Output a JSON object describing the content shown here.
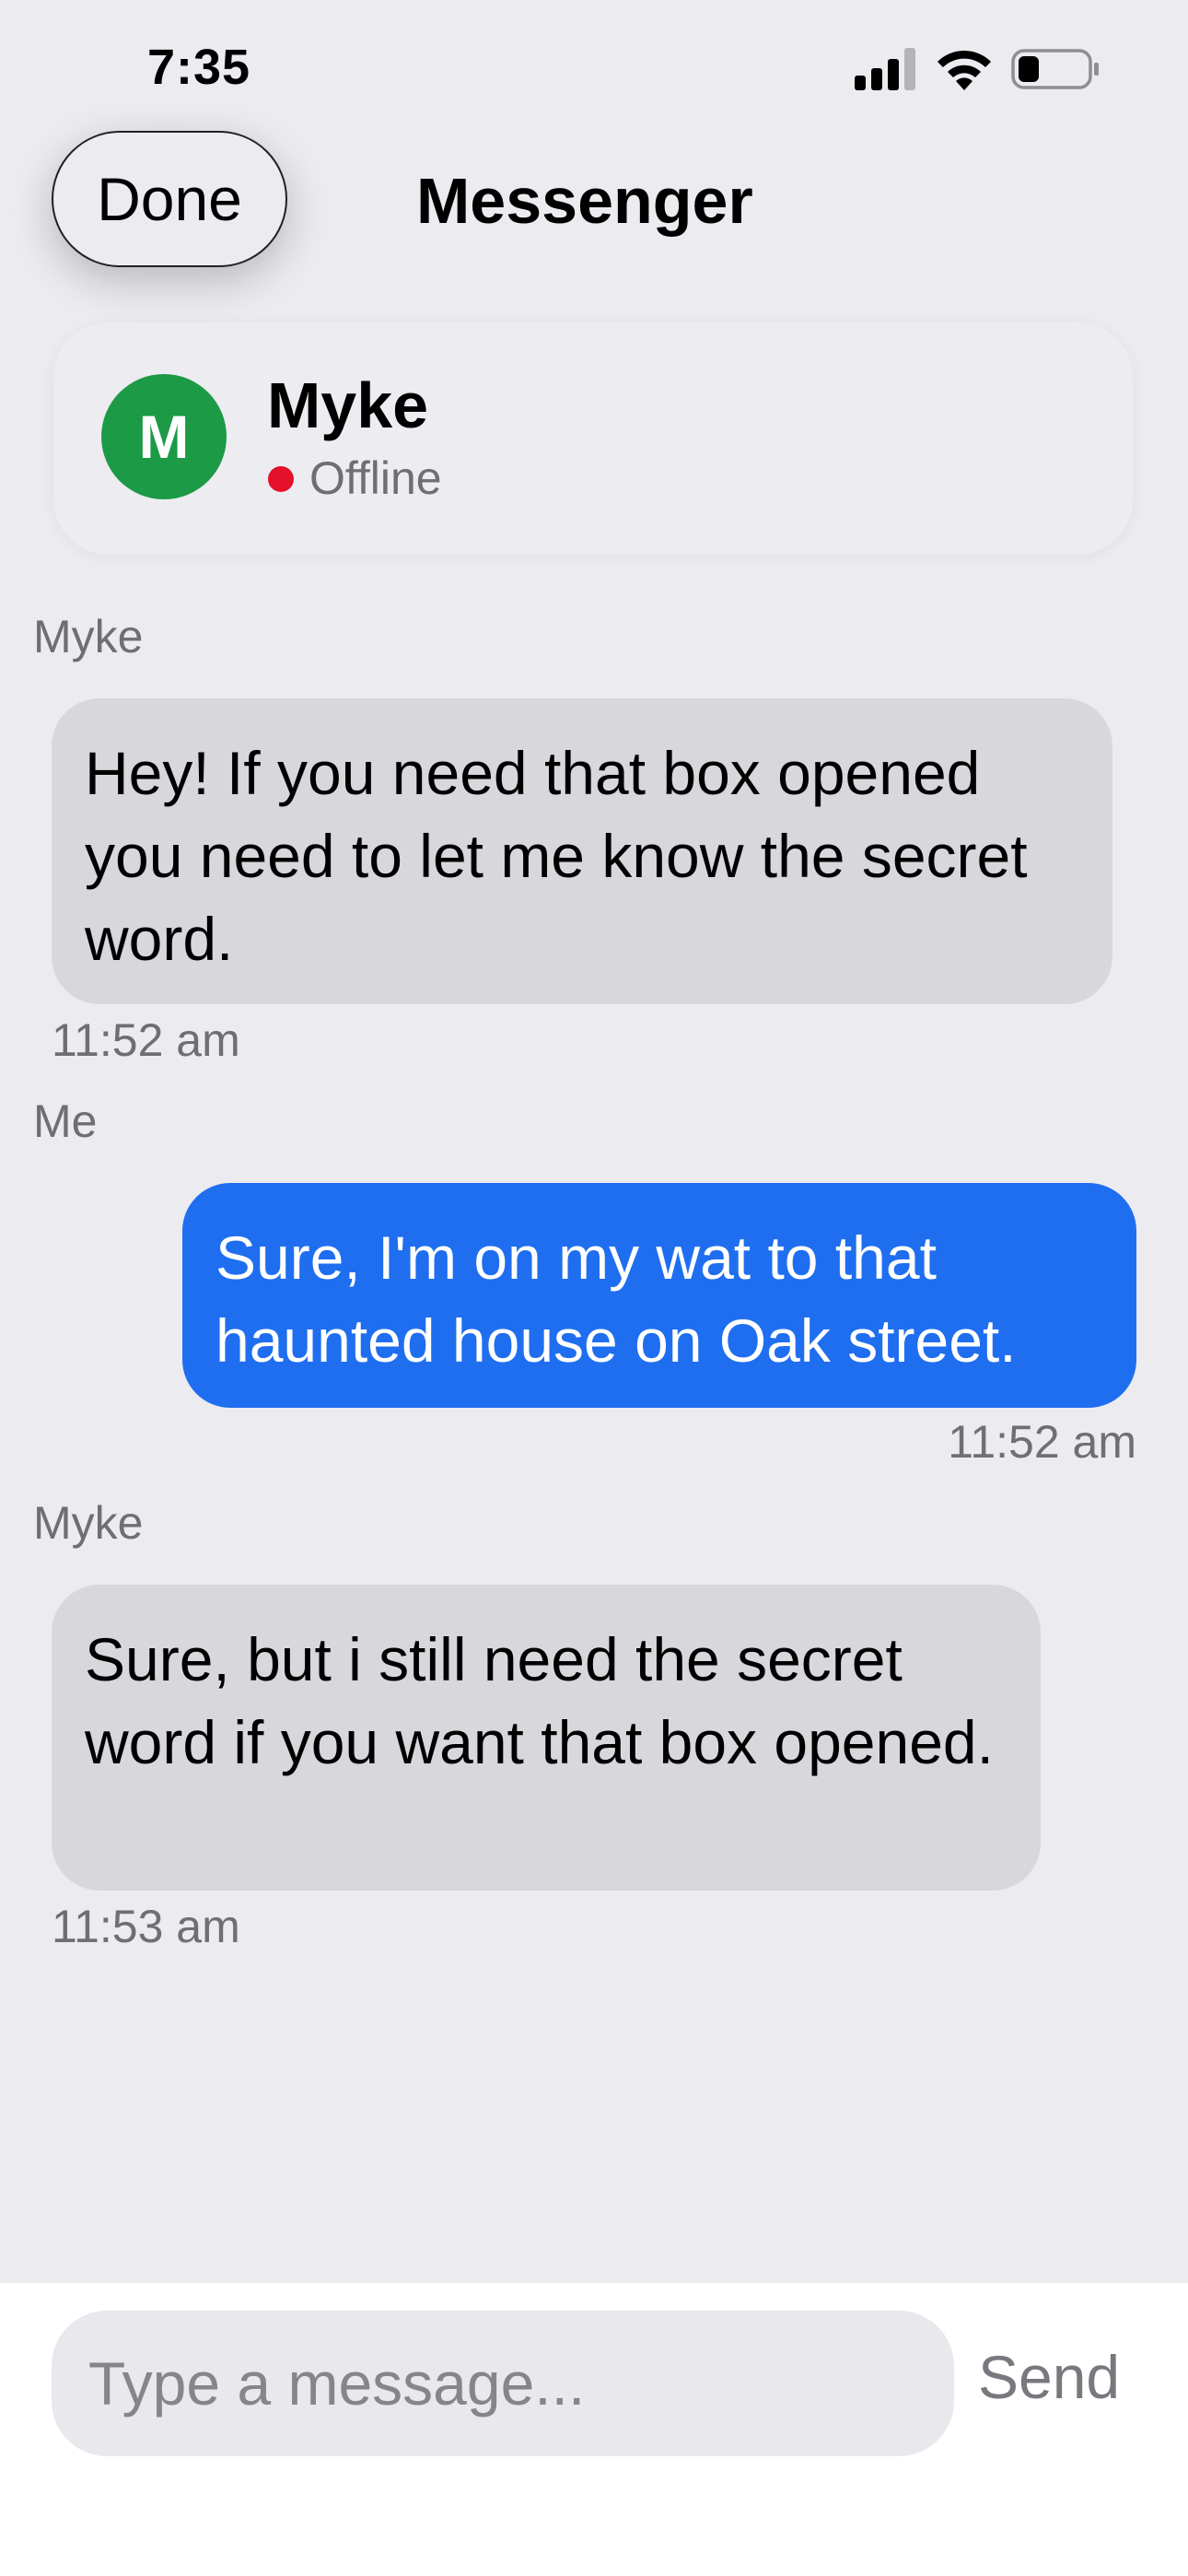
{
  "status_bar": {
    "time": "7:35",
    "icons": [
      "signal-icon",
      "wifi-icon",
      "battery-icon"
    ]
  },
  "nav": {
    "done_label": "Done",
    "title": "Messenger"
  },
  "contact": {
    "initial": "M",
    "name": "Myke",
    "status": "Offline",
    "avatar_color": "#1c9a46",
    "status_color": "#e5102a"
  },
  "messages": [
    {
      "sender": "Myke",
      "direction": "incoming",
      "text": "Hey! If you need that box opened you need to let me know the secret word.",
      "time": "11:52 am"
    },
    {
      "sender": "Me",
      "direction": "outgoing",
      "text": "Sure, I'm on my wat to that haunted house on Oak street.",
      "time": "11:52 am"
    },
    {
      "sender": "Myke",
      "direction": "incoming",
      "text": "Sure, but i still need the secret word if you want that box opened.",
      "time": "11:53 am"
    }
  ],
  "composer": {
    "placeholder": "Type a message...",
    "value": "",
    "send_label": "Send"
  },
  "colors": {
    "background": "#ebebf0",
    "outgoing_bubble": "#1f6ef0",
    "incoming_bubble": "#d7d7dc"
  }
}
